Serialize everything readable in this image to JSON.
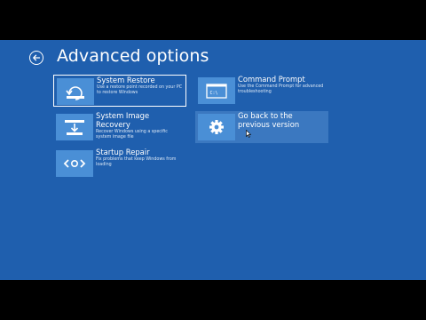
{
  "header": {
    "title": "Advanced options",
    "back_icon": "back-arrow-icon"
  },
  "options": [
    {
      "title": "System Restore",
      "desc": "Use a restore point recorded on your PC to restore Windows",
      "icon": "system-restore-icon",
      "selected": true
    },
    {
      "title": "System Image Recovery",
      "desc": "Recover Windows using a specific system image file",
      "icon": "system-image-recovery-icon"
    },
    {
      "title": "Startup Repair",
      "desc": "Fix problems that keep Windows from loading",
      "icon": "startup-repair-icon"
    },
    {
      "title": "Command Prompt",
      "desc": "Use the Command Prompt for advanced troubleshooting",
      "icon": "command-prompt-icon"
    },
    {
      "title": "Go back to the previous version",
      "desc": "",
      "icon": "gear-icon",
      "hover": true
    }
  ],
  "colors": {
    "background": "#1f5fae",
    "tile": "#4a8fd6",
    "hover": "#3b78c0",
    "text": "#ffffff"
  }
}
